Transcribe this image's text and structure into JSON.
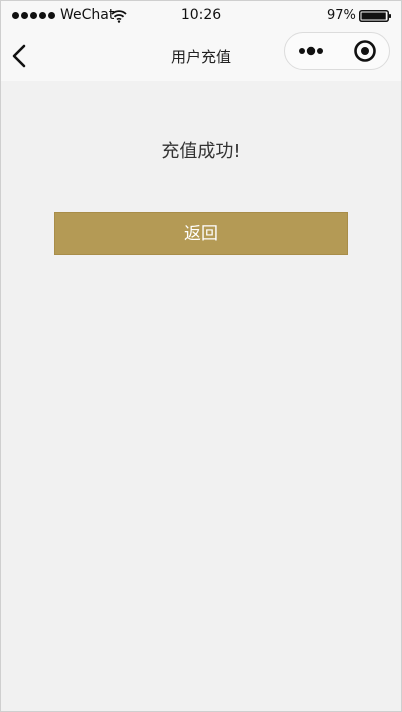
{
  "status_bar": {
    "carrier": "WeChat",
    "time": "10:26",
    "battery_percent": "97%",
    "battery_level": 0.97,
    "signal_bars": 5
  },
  "nav_bar": {
    "title": "用户充值"
  },
  "main": {
    "message": "充值成功!",
    "return_label": "返回"
  },
  "colors": {
    "button_bg": "#b49a55",
    "page_bg": "#f1f1f1",
    "bar_bg": "#f8f8f8"
  }
}
